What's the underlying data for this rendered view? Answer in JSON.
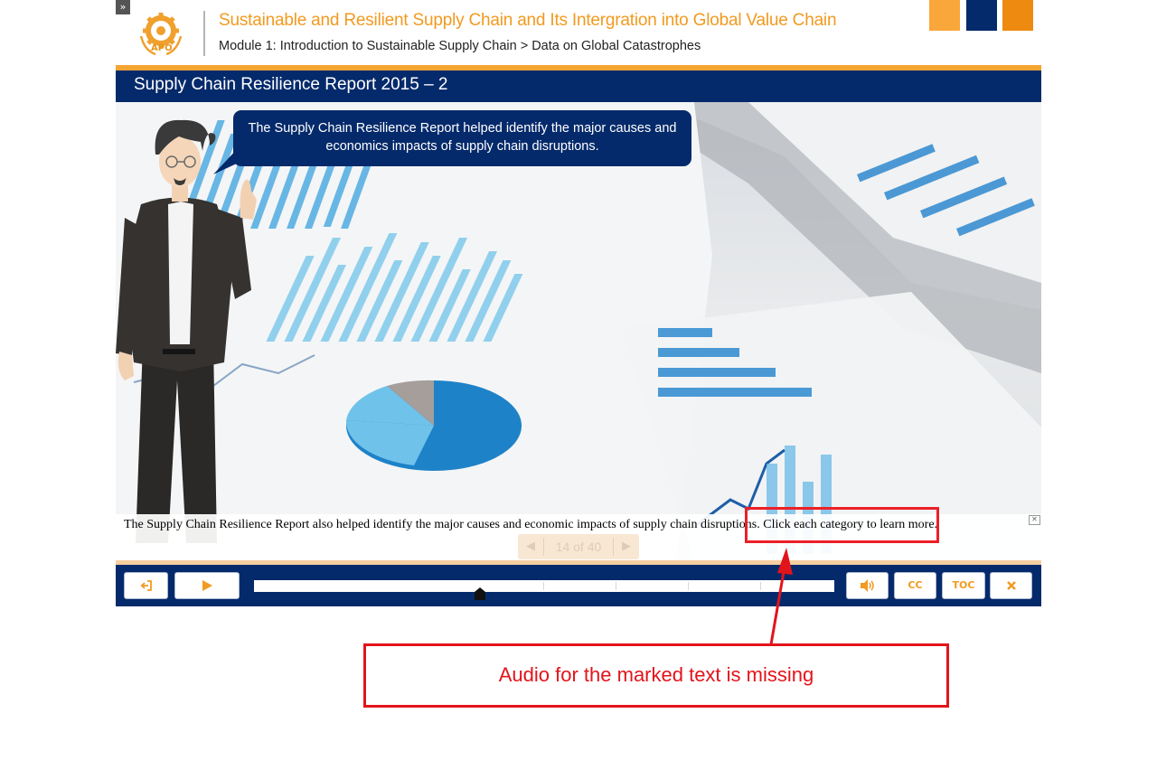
{
  "header": {
    "course_title": "Sustainable and Resilient Supply Chain and Its Intergration into Global Value Chain",
    "breadcrumb": "Module 1: Introduction to Sustainable Supply Chain > Data on Global Catastrophes",
    "logo_text": "APO",
    "brand_colors": [
      "#f9a73a",
      "#052a6b",
      "#ef8a11"
    ]
  },
  "slide": {
    "title": "Supply Chain Resilience Report 2015 – 2",
    "speech_bubble": "The Supply Chain Resilience Report helped identify the major causes and economics impacts of supply chain disruptions.",
    "caption": "The Supply Chain Resilience Report also helped identify the major causes and economic impacts of supply chain disruptions. Click each category to learn more.",
    "caption_close": "✕"
  },
  "pager": {
    "prev_icon": "◀",
    "next_icon": "▶",
    "label": "14 of 40"
  },
  "controls": {
    "exit_icon": "exit-icon",
    "play_icon": "play-icon",
    "volume_icon": "speaker-icon",
    "cc_label": "CC",
    "toc_label": "TOC",
    "close_icon": "close-x-icon",
    "progress_fraction": 0.39
  },
  "annotation": {
    "message": "Audio for the marked text is missing",
    "color": "#e2141b"
  },
  "expand_glyph": "»"
}
